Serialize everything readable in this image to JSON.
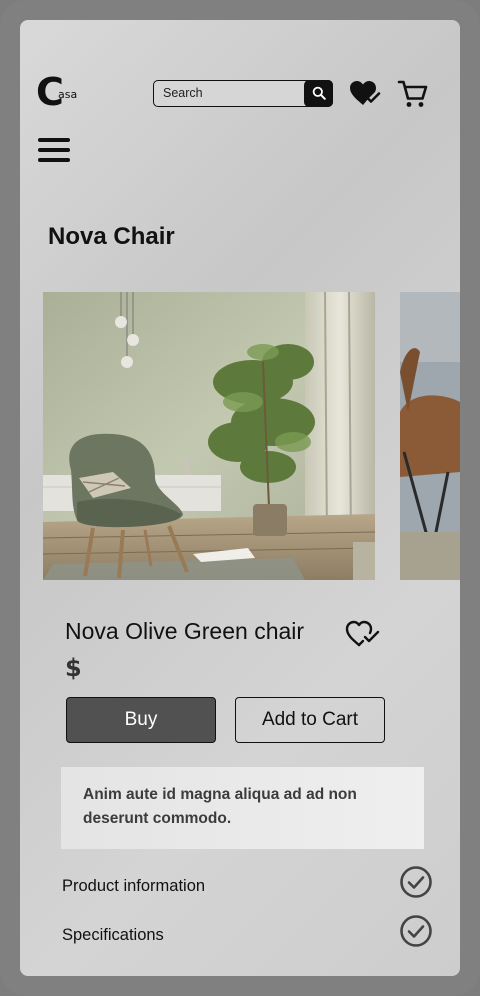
{
  "brand": {
    "logo_letter": "C",
    "logo_text": "asa"
  },
  "header": {
    "search_placeholder": "Search",
    "icons": [
      "search-icon",
      "wishlist-heart-check-icon",
      "cart-icon",
      "hamburger-menu-icon"
    ]
  },
  "page": {
    "title": "Nova Chair"
  },
  "product": {
    "name": "Nova Olive Green chair",
    "price": "$",
    "buy_label": "Buy",
    "add_to_cart_label": "Add to Cart",
    "description": "Anim aute id magna aliqua ad ad non deserunt commodo."
  },
  "sections": [
    {
      "label": "Product information",
      "icon": "check-circle-icon"
    },
    {
      "label": "Specifications",
      "icon": "check-circle-icon"
    }
  ],
  "colors": {
    "background": "#d4d4d4",
    "frame": "#808080",
    "buy_button": "#515151",
    "text": "#111111"
  }
}
